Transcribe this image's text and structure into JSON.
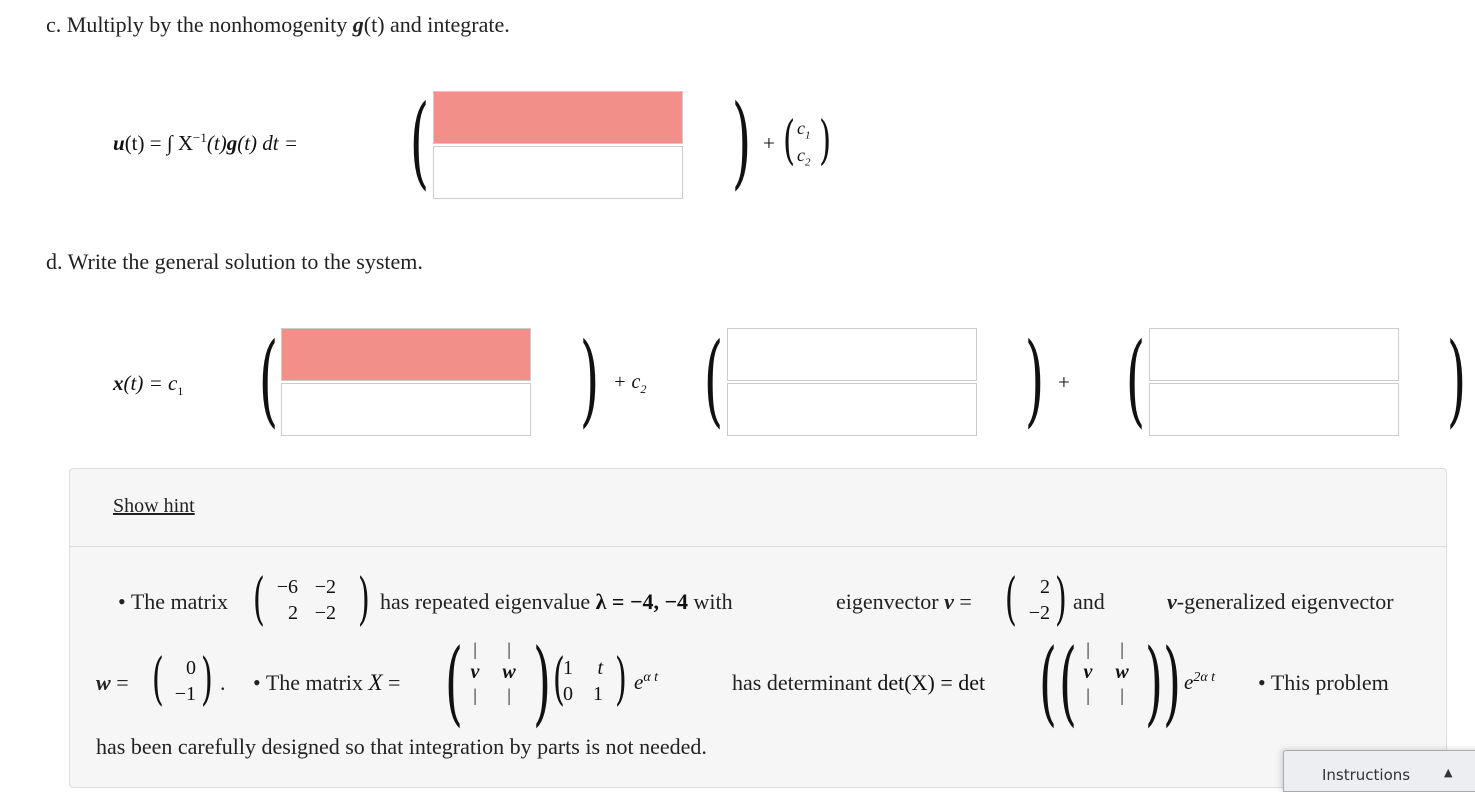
{
  "part_c": {
    "label": "c. Multiply by the nonhomogenity",
    "g_symbol": "g",
    "t_arg": "(t)",
    "label_suffix": "and integrate.",
    "lhs_u": "u",
    "lhs_rest": "(t) = ∫ X",
    "inverse_sup": "−1",
    "lhs_mid": "(t)",
    "lhs_g": "g",
    "lhs_end": "(t) dt =",
    "answers": [
      {
        "value": "",
        "status": "incorrect"
      },
      {
        "value": "",
        "status": "empty"
      }
    ],
    "plus": "+",
    "c1": "c",
    "c1_sub": "1",
    "c2": "c",
    "c2_sub": "2"
  },
  "part_d": {
    "label": "d. Write the general solution to the system.",
    "lhs_x": "x",
    "lhs_rest": "(t)",
    "eq_c1": "= c",
    "c1_sub": "1",
    "plus_c2": "+ c",
    "c2_sub": "2",
    "plus": "+",
    "vec1": [
      {
        "value": "",
        "status": "incorrect"
      },
      {
        "value": "",
        "status": "empty"
      }
    ],
    "vec2": [
      {
        "value": "",
        "status": "empty"
      },
      {
        "value": "",
        "status": "empty"
      }
    ],
    "vec3": [
      {
        "value": "",
        "status": "empty"
      },
      {
        "value": "",
        "status": "empty"
      }
    ]
  },
  "hint": {
    "toggle_label": "Show hint",
    "bullet": "•",
    "line1_a": "The matrix",
    "matrix_A": [
      "−6",
      "−2",
      "2",
      "−2"
    ],
    "line1_b": "has repeated eigenvalue",
    "lambda": "λ = −4, −4",
    "line1_c": "with",
    "eigvec_label": "eigenvector",
    "v_sym": "v",
    "eq": "=",
    "v_vals": [
      "2",
      "−2"
    ],
    "and": "and",
    "gen_label": "-generalized eigenvector",
    "w_sym": "w",
    "w_vals": [
      "0",
      "−1"
    ],
    "period": ".",
    "line2_a": "The matrix",
    "X_sym": "X",
    "bar": "|",
    "tri": [
      "1",
      "t",
      "0",
      "1"
    ],
    "exp_base": "e",
    "exp_sup": "α t",
    "det_label": "has determinant",
    "det_expr": "det(X) = det",
    "exp2_sup": "2α t",
    "line3_a": "This problem",
    "line4": "has been carefully designed so that integration by parts is not needed."
  },
  "instructions_tab": {
    "label": "Instructions",
    "icon": "chevron-up-icon"
  },
  "colors": {
    "incorrect_fill": "#f28f89",
    "box_border": "#cccccc",
    "hint_bg": "#f6f6f6"
  }
}
